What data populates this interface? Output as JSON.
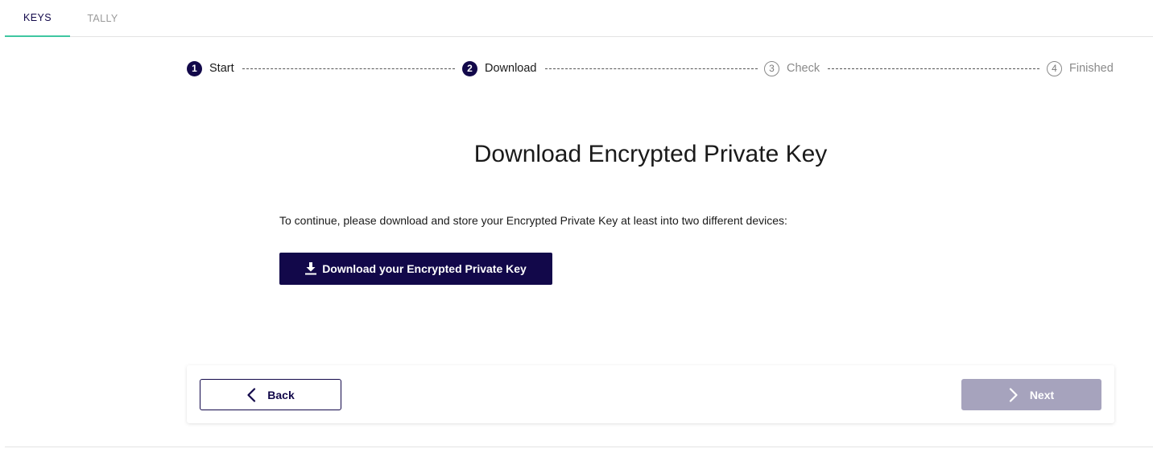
{
  "tabs": [
    {
      "label": "KEYS",
      "active": true
    },
    {
      "label": "TALLY",
      "active": false
    }
  ],
  "stepper": {
    "steps": [
      {
        "number": "1",
        "label": "Start",
        "state": "completed"
      },
      {
        "number": "2",
        "label": "Download",
        "state": "active"
      },
      {
        "number": "3",
        "label": "Check",
        "state": "pending"
      },
      {
        "number": "4",
        "label": "Finished",
        "state": "pending"
      }
    ]
  },
  "main": {
    "title": "Download Encrypted Private Key",
    "instructions": "To continue, please download and store your Encrypted Private Key at least into two different devices:",
    "download_button": {
      "label": "Download your Encrypted Private Key",
      "icon": "download-icon"
    }
  },
  "footer": {
    "back_label": "Back",
    "next_label": "Next",
    "next_enabled": false
  },
  "colors": {
    "primary": "#12084a",
    "tab_indicator": "#3fc6a0",
    "disabled_button": "#a6a3bd"
  }
}
